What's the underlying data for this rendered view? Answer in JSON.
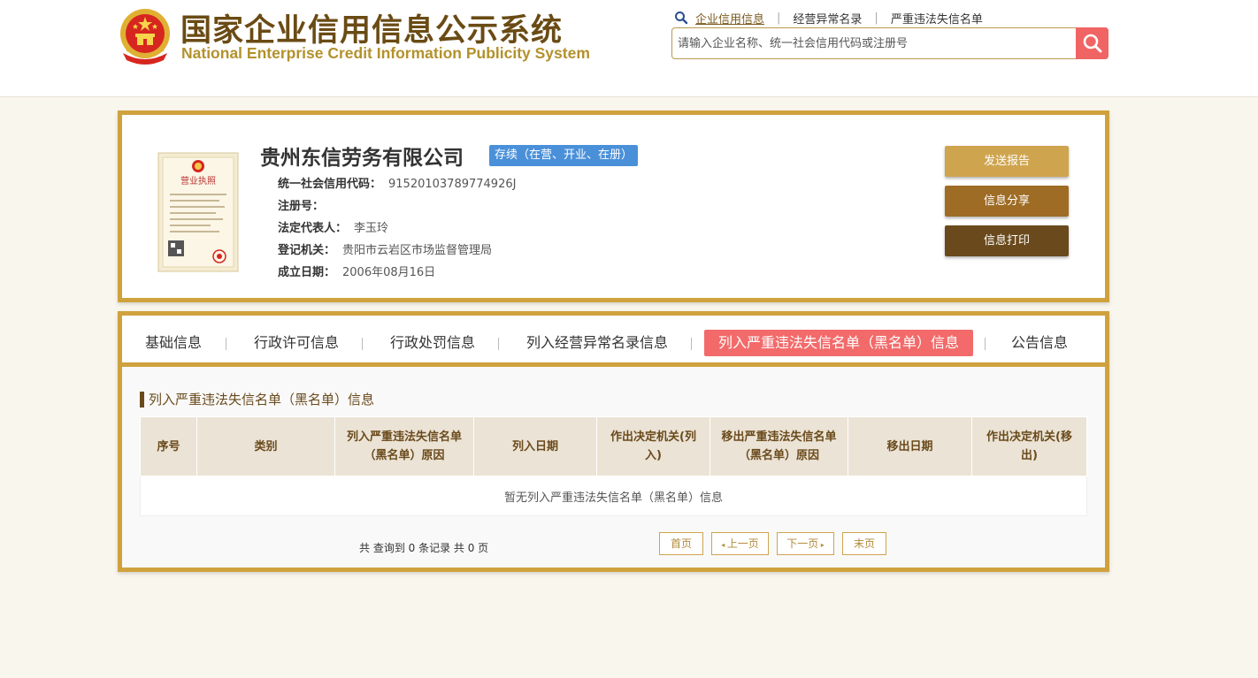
{
  "header": {
    "title_cn": "国家企业信用信息公示系统",
    "title_en": "National Enterprise Credit Information Publicity System",
    "emblem_icon": "national-emblem-icon",
    "nav": [
      {
        "label": "企业信用信息",
        "active": true
      },
      {
        "label": "经营异常名录",
        "active": false
      },
      {
        "label": "严重违法失信名单",
        "active": false
      }
    ],
    "nav_sep": "|",
    "search_placeholder": "请输入企业名称、统一社会信用代码或注册号",
    "search_icon": "search-icon"
  },
  "company": {
    "name": "贵州东信劳务有限公司",
    "status": "存续（在营、开业、在册）",
    "fields": [
      {
        "label": "统一社会信用代码：",
        "value": "91520103789774926J"
      },
      {
        "label": "注册号：",
        "value": ""
      },
      {
        "label": "法定代表人：",
        "value": "李玉玲"
      },
      {
        "label": "登记机关：",
        "value": "贵阳市云岩区市场监督管理局"
      },
      {
        "label": "成立日期：",
        "value": "2006年08月16日"
      }
    ],
    "license_image_title": "营业执照",
    "buttons": {
      "send": "发送报告",
      "share": "信息分享",
      "print": "信息打印"
    }
  },
  "tabs": [
    {
      "label": "基础信息",
      "active": false
    },
    {
      "label": "行政许可信息",
      "active": false
    },
    {
      "label": "行政处罚信息",
      "active": false
    },
    {
      "label": "列入经营异常名录信息",
      "active": false
    },
    {
      "label": "列入严重违法失信名单（黑名单）信息",
      "active": true
    },
    {
      "label": "公告信息",
      "active": false
    }
  ],
  "section": {
    "title": "列入严重违法失信名单（黑名单）信息",
    "columns": [
      {
        "label": "序号"
      },
      {
        "label": "类别"
      },
      {
        "label": "列入严重违法失信名单（黑名单）原因"
      },
      {
        "label": "列入日期"
      },
      {
        "label": "作出决定机关(列入)"
      },
      {
        "label": "移出严重违法失信名单（黑名单）原因"
      },
      {
        "label": "移出日期"
      },
      {
        "label": "作出决定机关(移出)"
      }
    ],
    "empty_message": "暂无列入严重违法失信名单（黑名单）信息"
  },
  "pagination": {
    "summary": "共 查询到 0 条记录 共 0 页",
    "first": "首页",
    "prev": "上一页",
    "next": "下一页",
    "last": "末页"
  },
  "colors": {
    "gold_border": "#cfa23e",
    "brown_text": "#6a4a1c",
    "active_tab": "#f26a6a",
    "status_badge": "#4a90d9",
    "search_button": "#f06464"
  }
}
